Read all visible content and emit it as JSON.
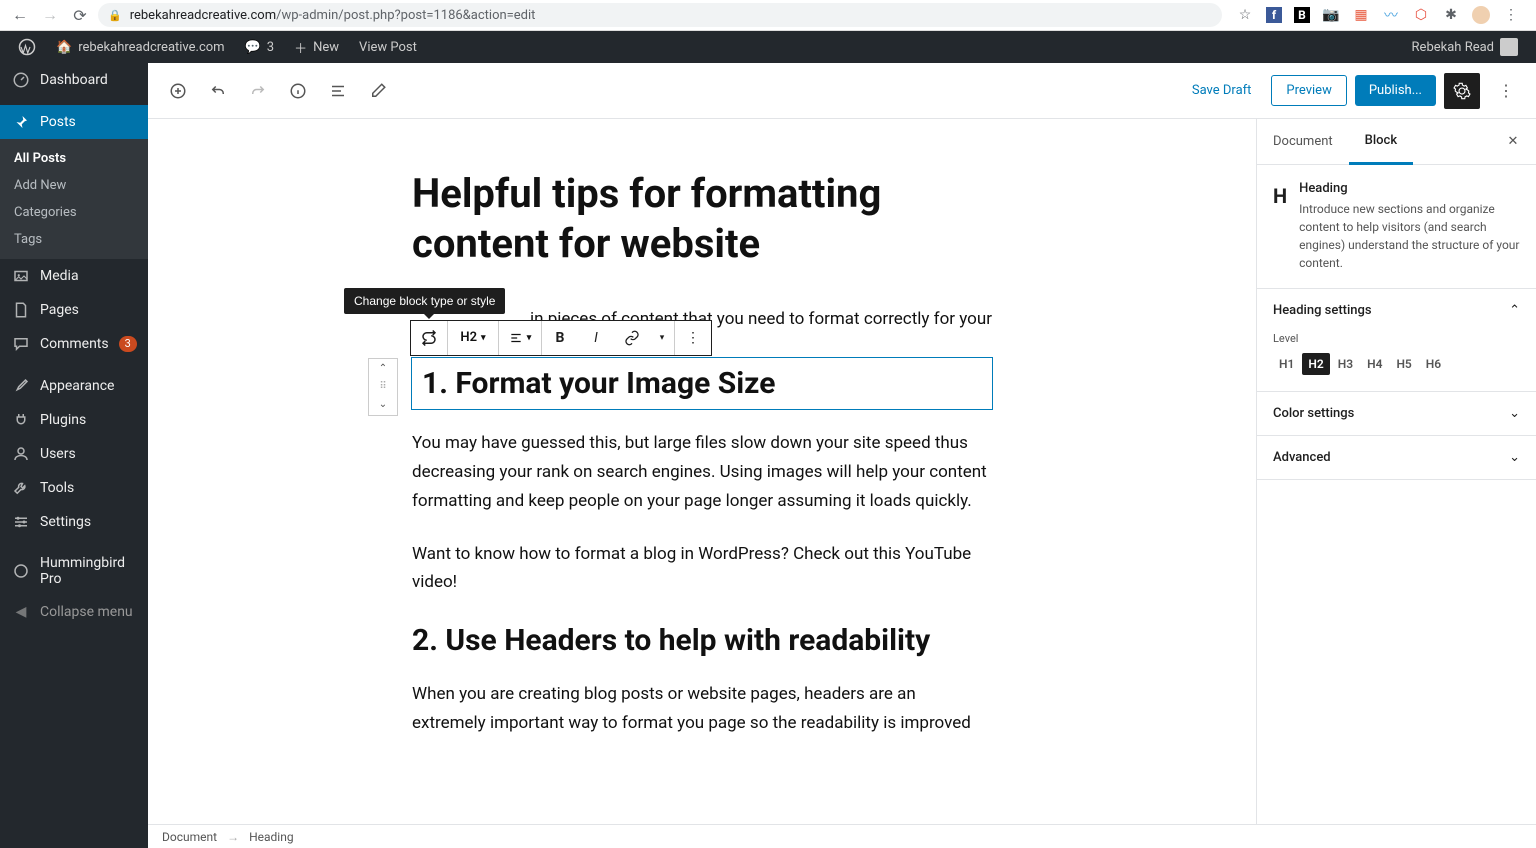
{
  "browser": {
    "url_domain": "rebekahreadcreative.com",
    "url_path": "/wp-admin/post.php?post=1186&action=edit"
  },
  "admin_bar": {
    "site_name": "rebekahreadcreative.com",
    "comments_count": "3",
    "new_label": "New",
    "view_post": "View Post",
    "user_name": "Rebekah Read"
  },
  "sidebar": {
    "dashboard": "Dashboard",
    "posts": "Posts",
    "submenu": {
      "all_posts": "All Posts",
      "add_new": "Add New",
      "categories": "Categories",
      "tags": "Tags"
    },
    "media": "Media",
    "pages": "Pages",
    "comments": "Comments",
    "comments_badge": "3",
    "appearance": "Appearance",
    "plugins": "Plugins",
    "users": "Users",
    "tools": "Tools",
    "settings": "Settings",
    "hummingbird": "Hummingbird Pro",
    "collapse": "Collapse menu"
  },
  "toolbar": {
    "save_draft": "Save Draft",
    "preview": "Preview",
    "publish": "Publish..."
  },
  "content": {
    "title": "Helpful tips for formatting content for website",
    "p1_partial": "in pieces of content that you need to format correctly for your",
    "h2_1": "1. Format your Image Size",
    "p2": "You may have guessed this, but large files slow down your site speed thus decreasing your rank on search engines. Using images will help your content formatting and keep people on your page longer assuming it loads quickly.",
    "p3": "Want to know how to format a blog in WordPress? Check out this YouTube video!",
    "h2_2": "2. Use Headers to help with readability",
    "p4": "When you are creating blog posts or website pages, headers are an extremely important way to format you page so the readability is improved"
  },
  "block_toolbar": {
    "tooltip": "Change block type or style",
    "heading_level": "H2"
  },
  "settings": {
    "tab_document": "Document",
    "tab_block": "Block",
    "block_type": "Heading",
    "block_desc": "Introduce new sections and organize content to help visitors (and search engines) understand the structure of your content.",
    "heading_settings": "Heading settings",
    "level_label": "Level",
    "levels": [
      "H1",
      "H2",
      "H3",
      "H4",
      "H5",
      "H6"
    ],
    "active_level": "H2",
    "color_settings": "Color settings",
    "advanced": "Advanced"
  },
  "footer": {
    "crumb1": "Document",
    "crumb2": "Heading"
  }
}
